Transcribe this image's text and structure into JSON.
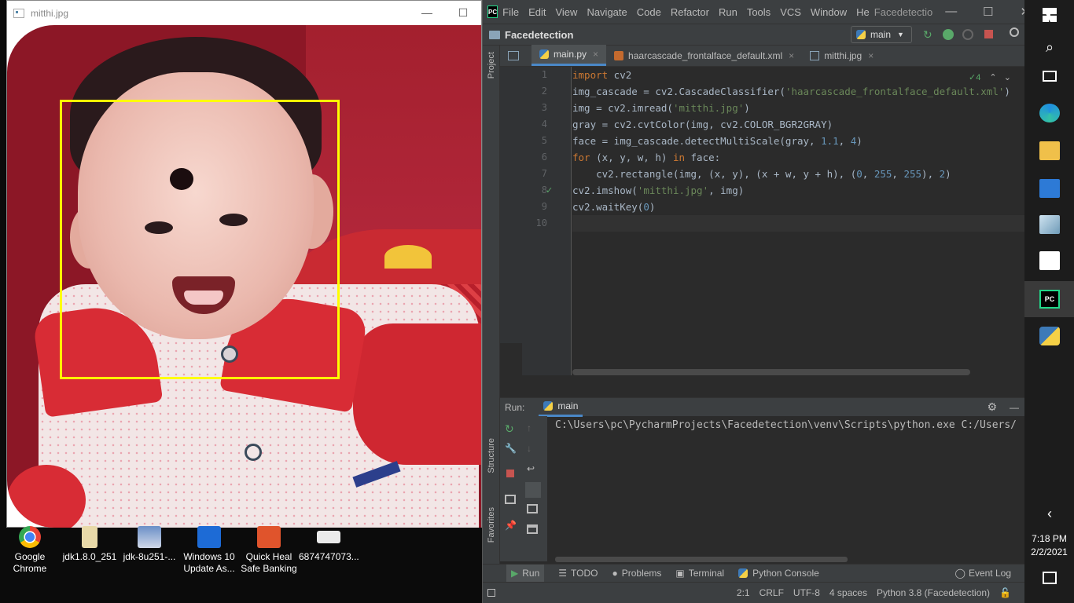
{
  "image_window": {
    "title": "mitthi.jpg",
    "minimize": "—",
    "maximize": "☐"
  },
  "desktop_icons": [
    {
      "label": "Google Chrome",
      "line1": "Google",
      "line2": "Chrome",
      "color": "#4285f4"
    },
    {
      "label": "jdk1.8.0_251",
      "line1": "jdk1.8.0_251",
      "line2": "",
      "color": "#e8c76a"
    },
    {
      "label": "jdk-8u251-...",
      "line1": "jdk-8u251-...",
      "line2": "",
      "color": "#6a8fc7"
    },
    {
      "label": "Windows 10 Update As...",
      "line1": "Windows 10",
      "line2": "Update As...",
      "color": "#1d6bd6"
    },
    {
      "label": "Quick Heal Safe Banking",
      "line1": "Quick Heal",
      "line2": "Safe Banking",
      "color": "#e0542c"
    },
    {
      "label": "6874747073...",
      "line1": "6874747073...",
      "line2": "",
      "color": "#eaeaea"
    }
  ],
  "ide": {
    "menu": [
      "File",
      "Edit",
      "View",
      "Navigate",
      "Code",
      "Refactor",
      "Run",
      "Tools",
      "VCS",
      "Window",
      "He"
    ],
    "window_title": "Facedetectio",
    "project": "Facedetection",
    "run_config": "main",
    "tabs": [
      {
        "label": "main.py",
        "active": true
      },
      {
        "label": "haarcascade_frontalface_default.xml",
        "active": false
      },
      {
        "label": "mitthi.jpg",
        "active": false
      }
    ],
    "inspection_count": "4",
    "line_numbers": [
      "1",
      "2",
      "3",
      "4",
      "5",
      "6",
      "7",
      "8",
      "9",
      "10"
    ],
    "code": [
      [
        {
          "t": "import",
          "c": "kw"
        },
        {
          "t": " cv2",
          "c": ""
        }
      ],
      [
        {
          "t": "img_cascade = cv2.CascadeClassifier(",
          "c": ""
        },
        {
          "t": "'haarcascade_frontalface_default.xml'",
          "c": "str"
        },
        {
          "t": ")",
          "c": ""
        }
      ],
      [
        {
          "t": "img = cv2.imread(",
          "c": ""
        },
        {
          "t": "'mitthi.jpg'",
          "c": "str"
        },
        {
          "t": ")",
          "c": ""
        }
      ],
      [
        {
          "t": "gray = cv2.cvtColor(img, cv2.COLOR_BGR2GRAY)",
          "c": ""
        }
      ],
      [
        {
          "t": "face = img_cascade.detectMultiScale(gray, ",
          "c": ""
        },
        {
          "t": "1.1",
          "c": "num"
        },
        {
          "t": ", ",
          "c": ""
        },
        {
          "t": "4",
          "c": "num"
        },
        {
          "t": ")",
          "c": ""
        }
      ],
      [
        {
          "t": "for",
          "c": "kw"
        },
        {
          "t": " (x, y, w, h) ",
          "c": ""
        },
        {
          "t": "in",
          "c": "kw"
        },
        {
          "t": " face:",
          "c": ""
        }
      ],
      [
        {
          "t": "    cv2.rectangle(img, (x, y), (x + w, y + h), (",
          "c": ""
        },
        {
          "t": "0",
          "c": "num"
        },
        {
          "t": ", ",
          "c": ""
        },
        {
          "t": "255",
          "c": "num"
        },
        {
          "t": ", ",
          "c": ""
        },
        {
          "t": "255",
          "c": "num"
        },
        {
          "t": "), ",
          "c": ""
        },
        {
          "t": "2",
          "c": "num"
        },
        {
          "t": ")",
          "c": ""
        }
      ],
      [
        {
          "t": "cv2.imshow(",
          "c": ""
        },
        {
          "t": "'mitthi.jpg'",
          "c": "str"
        },
        {
          "t": ", img)",
          "c": ""
        }
      ],
      [
        {
          "t": "cv2.waitKey(",
          "c": ""
        },
        {
          "t": "0",
          "c": "num"
        },
        {
          "t": ")",
          "c": ""
        }
      ],
      [
        {
          "t": "",
          "c": ""
        }
      ]
    ],
    "run_label": "Run:",
    "run_tab": "main",
    "console_line": "C:\\Users\\pc\\PycharmProjects\\Facedetection\\venv\\Scripts\\python.exe C:/Users/",
    "left_tool_labels": {
      "project": "Project",
      "structure": "Structure",
      "favorites": "Favorites"
    },
    "bottom_tools": [
      "Run",
      "TODO",
      "Problems",
      "Terminal",
      "Python Console"
    ],
    "event_log": "Event Log",
    "status": {
      "position": "2:1",
      "line_sep": "CRLF",
      "encoding": "UTF-8",
      "indent": "4 spaces",
      "interpreter": "Python 3.8 (Facedetection)"
    }
  },
  "taskbar": {
    "time": "7:18 PM",
    "date": "2/2/2021"
  },
  "colors": {
    "ide_bg": "#2b2b2b",
    "ide_panel": "#3c3f41",
    "keyword": "#cc7832",
    "string": "#6a8759",
    "number": "#6897bb",
    "detect_box": "#ffff00"
  }
}
